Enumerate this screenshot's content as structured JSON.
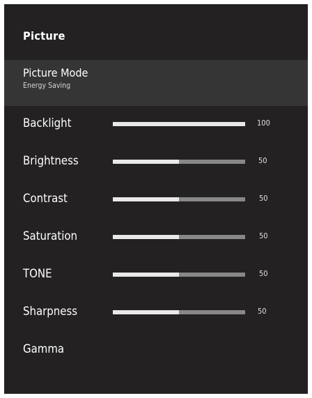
{
  "page": {
    "title": "Picture"
  },
  "picture_mode": {
    "label": "Picture Mode",
    "value": "Energy Saving"
  },
  "settings": [
    {
      "label": "Backlight",
      "value": "100",
      "level": 1.0
    },
    {
      "label": "Brightness",
      "value": "50",
      "level": 0.5
    },
    {
      "label": "Contrast",
      "value": "50",
      "level": 0.5
    },
    {
      "label": "Saturation",
      "value": "50",
      "level": 0.5
    },
    {
      "label": "TONE",
      "value": "50",
      "level": 0.5
    },
    {
      "label": "Sharpness",
      "value": "50",
      "level": 0.5
    }
  ],
  "gamma": {
    "label": "Gamma"
  },
  "colors": {
    "panel_background": "#232122",
    "selected_row": "#363536",
    "bar_track": "#888888",
    "bar_fill": "#e9e9e9"
  }
}
